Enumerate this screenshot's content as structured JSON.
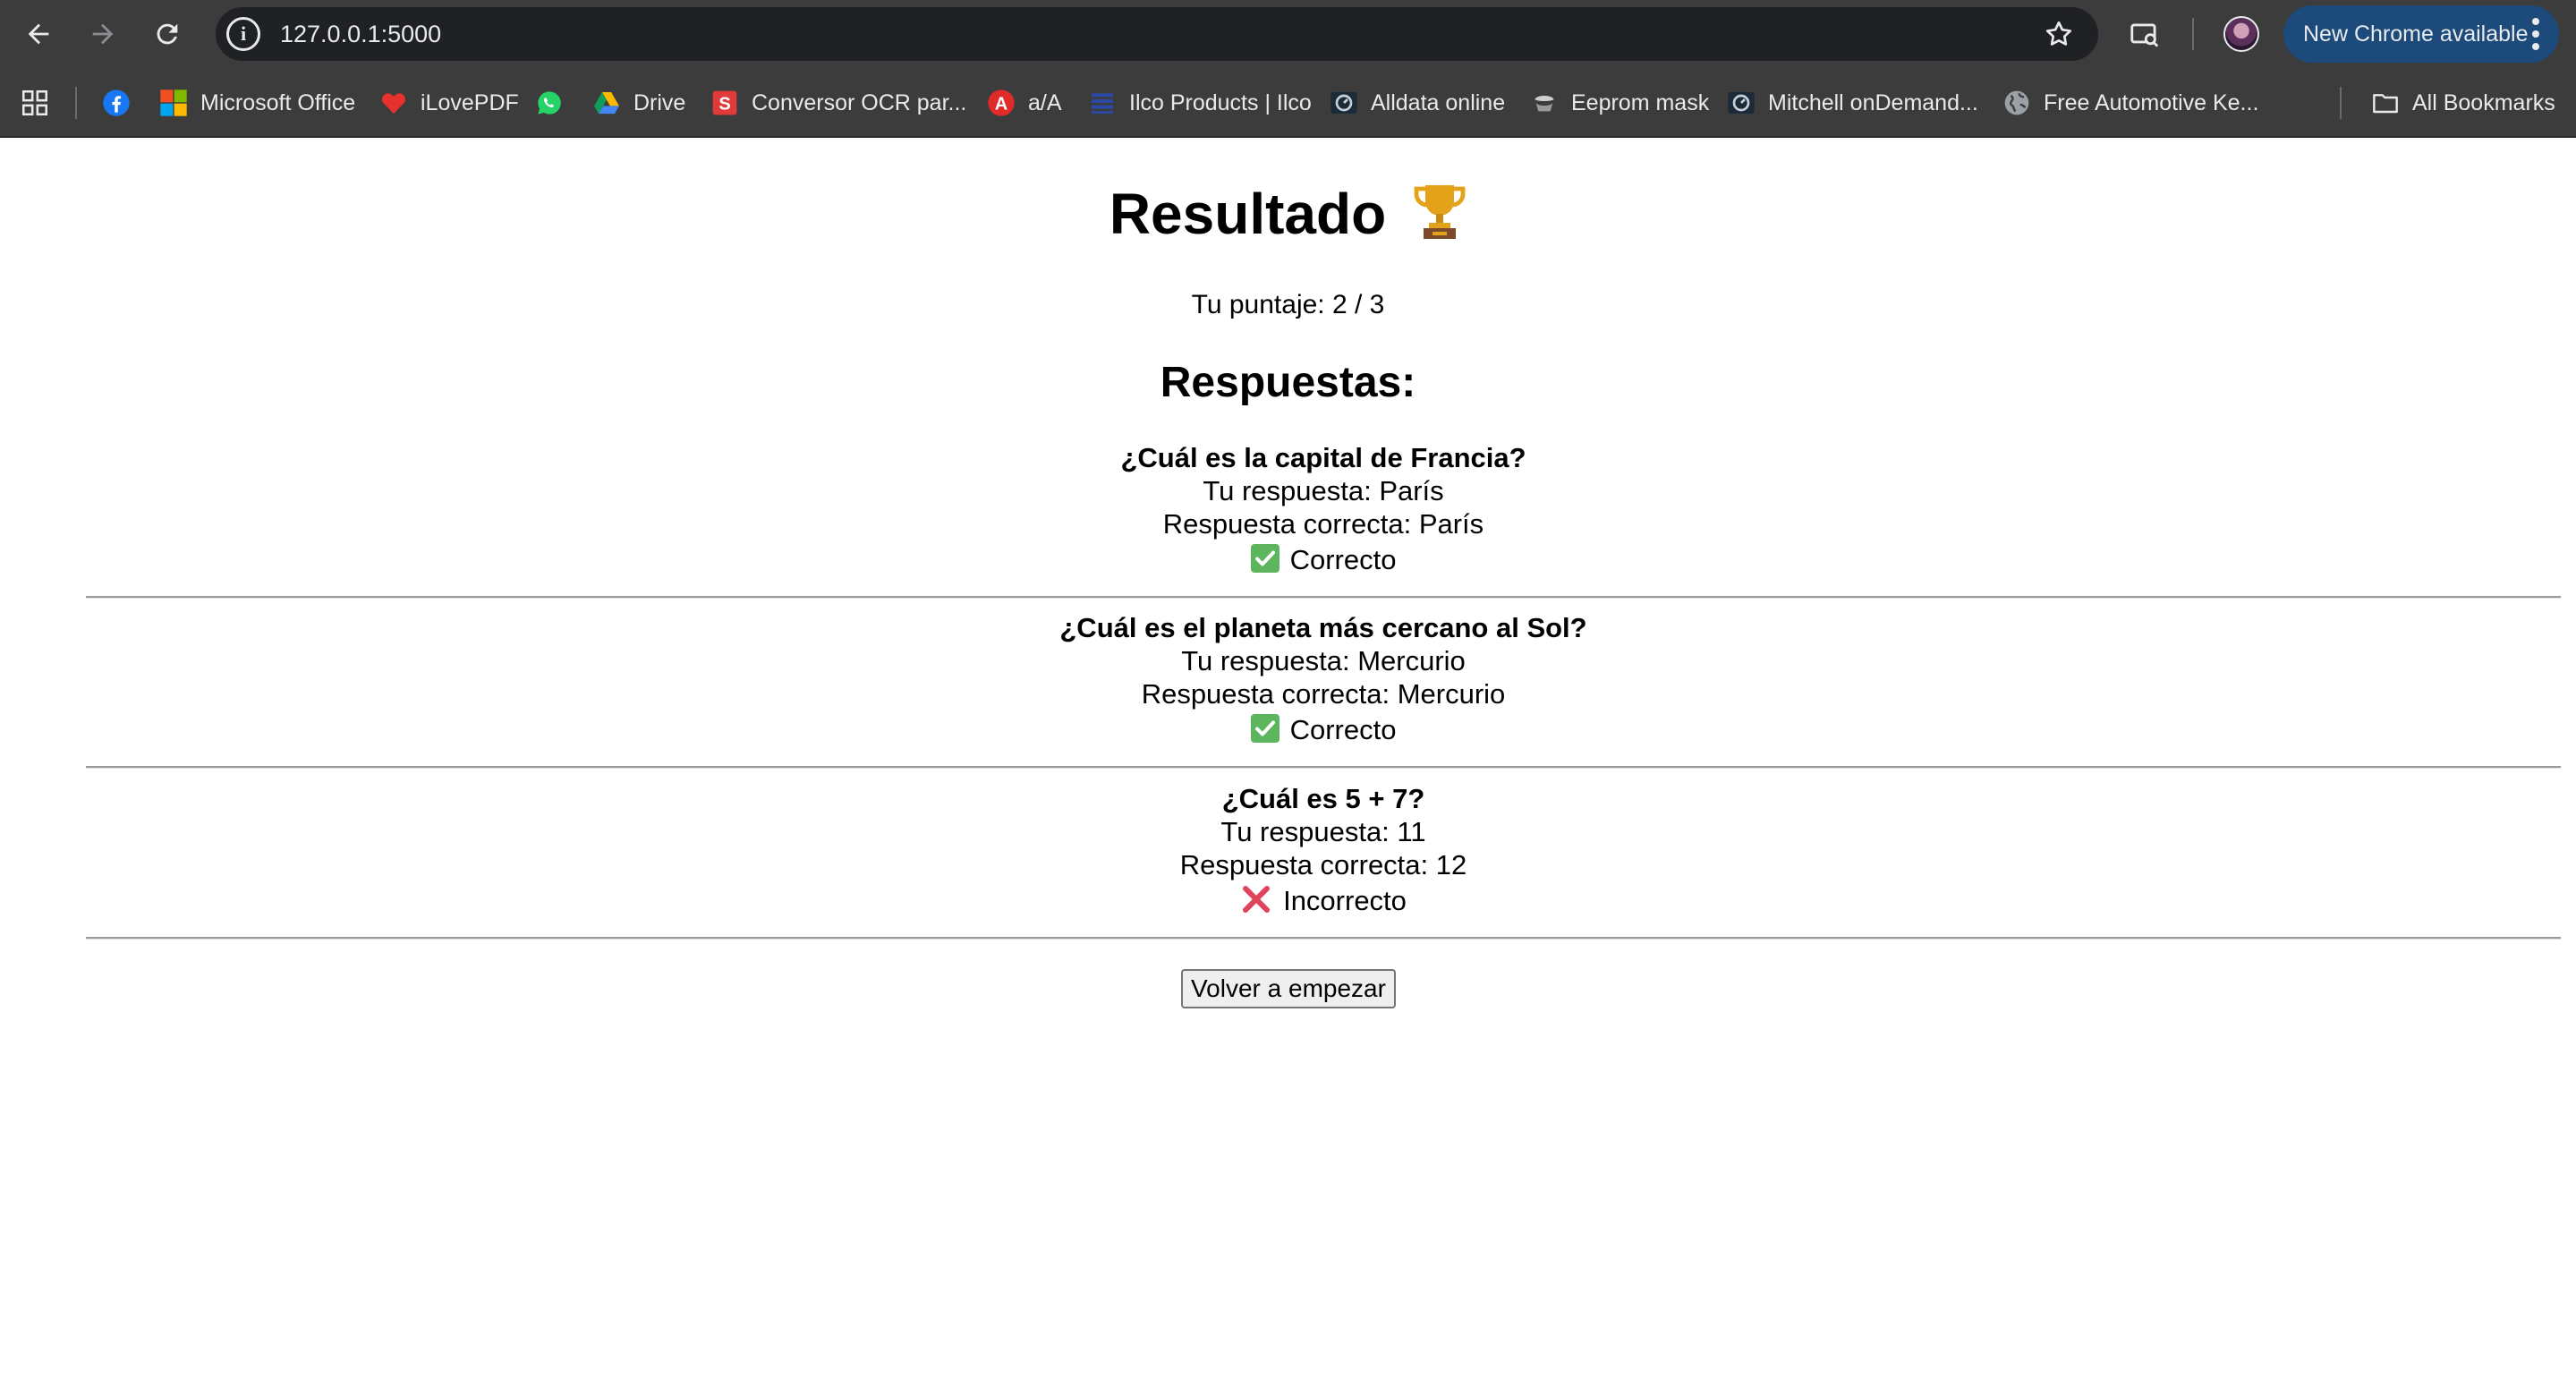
{
  "browser": {
    "url": "127.0.0.1:5000",
    "update_label": "New Chrome available",
    "bookmarks": [
      {
        "label": "",
        "icon": "facebook-icon"
      },
      {
        "label": "Microsoft Office",
        "icon": "microsoft-office-icon"
      },
      {
        "label": "iLovePDF",
        "icon": "ilovepdf-icon"
      },
      {
        "label": "",
        "icon": "whatsapp-icon"
      },
      {
        "label": "Drive",
        "icon": "google-drive-icon"
      },
      {
        "label": "Conversor OCR par...",
        "icon": "ocr-converter-icon"
      },
      {
        "label": "a/A",
        "icon": "text-case-icon"
      },
      {
        "label": "Ilco Products | Ilco",
        "icon": "ilco-icon"
      },
      {
        "label": "Alldata online",
        "icon": "alldata-icon"
      },
      {
        "label": "Eeprom mask",
        "icon": "eeprom-icon"
      },
      {
        "label": "Mitchell onDemand...",
        "icon": "mitchell-icon"
      },
      {
        "label": "Free Automotive Ke...",
        "icon": "globe-icon"
      }
    ],
    "all_bookmarks_label": "All Bookmarks"
  },
  "page": {
    "title": "Resultado",
    "score_text": "Tu puntaje: 2 / 3",
    "answers_heading": "Respuestas:",
    "questions": [
      {
        "question": "¿Cuál es la capital de Francia?",
        "your_answer": "Tu respuesta: París",
        "correct_answer": "Respuesta correcta: París",
        "result": "Correcto",
        "result_icon": "check-icon"
      },
      {
        "question": "¿Cuál es el planeta más cercano al Sol?",
        "your_answer": "Tu respuesta: Mercurio",
        "correct_answer": "Respuesta correcta: Mercurio",
        "result": "Correcto",
        "result_icon": "check-icon"
      },
      {
        "question": "¿Cuál es 5 + 7?",
        "your_answer": "Tu respuesta: 11",
        "correct_answer": "Respuesta correcta: 12",
        "result": "Incorrecto",
        "result_icon": "cross-icon"
      }
    ],
    "restart_button": "Volver a empezar"
  },
  "colors": {
    "chrome_bg": "#3c3c3c",
    "omnibox_bg": "#202124",
    "update_pill": "#1c4a7a",
    "check_green": "#5db55d",
    "cross_red": "#e0445c"
  }
}
